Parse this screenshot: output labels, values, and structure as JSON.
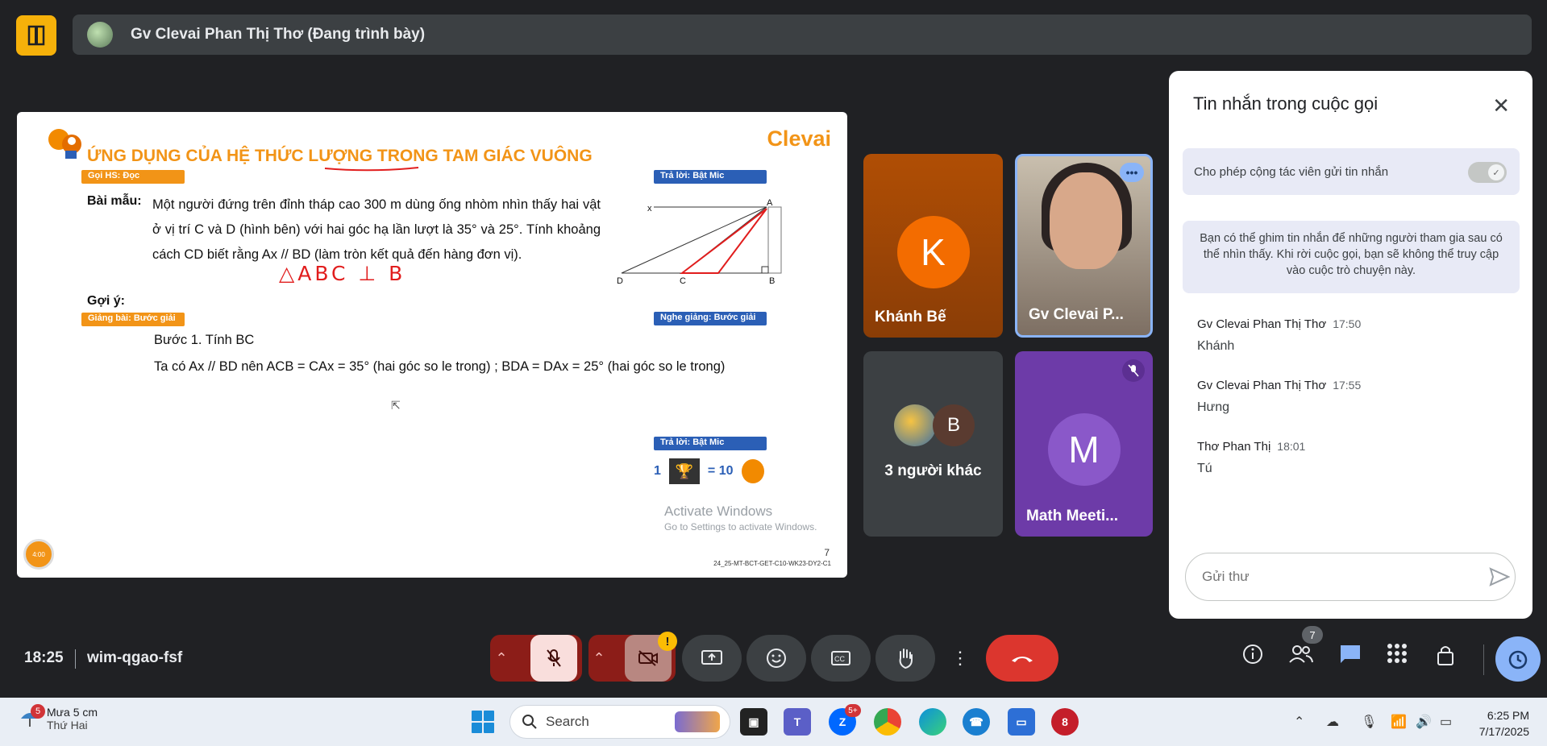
{
  "header": {
    "presenter_name": "Gv Clevai Phan Thị Thơ (Đang trình bày)"
  },
  "slide": {
    "title": "ỨNG DỤNG CỦA HỆ THỨC LƯỢNG TRONG TAM GIÁC VUÔNG",
    "brand": "Clevai",
    "tag_call_student": "Gọi HS: Đọc",
    "tag_answer_top": "Trả lời: Bật Mic",
    "sample_label": "Bài mẫu:",
    "problem": "Một người đứng trên đỉnh tháp cao 300 m dùng ống nhòm nhìn thấy hai vật ở vị trí C và D (hình bên) với hai góc hạ lần lượt là 35° và 25°. Tính khoảng cách CD biết rằng Ax // BD (làm tròn kết quả đến hàng đơn vị).",
    "handwriting": "△ABC ⊥ B",
    "hint_label": "Gợi ý:",
    "tag_lecture": "Giảng bài: Bước giải",
    "tag_listen": "Nghe giảng: Bước giải",
    "step1": "Bước 1. Tính BC",
    "equation": "Ta có Ax // BD nên ACB = CAx = 35° (hai góc so le trong) ; BDA = DAx = 25° (hai góc so le trong)",
    "tag_answer_bottom": "Trả lời: Bật Mic",
    "reward_count": "1",
    "reward_equals": "= 10",
    "diagram_labels": {
      "x": "x",
      "a": "A",
      "d": "D",
      "c": "C",
      "b": "B"
    },
    "activate_line1": "Activate Windows",
    "activate_line2": "Go to Settings to activate Windows.",
    "page_number": "7",
    "slide_code": "24_25-MT-BCT-GET-C10-WK23-DY2-C1",
    "timer": "4:00"
  },
  "participants": [
    {
      "name": "Khánh Bế",
      "initial": "K",
      "color": "#f36c00"
    },
    {
      "name": "Gv Clevai P..."
    },
    {
      "name": "3 người khác",
      "initial": "B"
    },
    {
      "name": "Math Meeti...",
      "initial": "M",
      "color": "#8a58c9"
    }
  ],
  "chat": {
    "title": "Tin nhắn trong cuộc gọi",
    "allow_label": "Cho phép cộng tác viên gửi tin nhắn",
    "info": "Bạn có thể ghim tin nhắn để những người tham gia sau có thể nhìn thấy. Khi rời cuộc gọi, bạn sẽ không thể truy cập vào cuộc trò chuyện này.",
    "messages": [
      {
        "sender": "Gv Clevai Phan Thị Thơ",
        "time": "17:50",
        "text": "Khánh"
      },
      {
        "sender": "Gv Clevai Phan Thị Thơ",
        "time": "17:55",
        "text": "Hưng"
      },
      {
        "sender": "Thơ Phan Thị",
        "time": "18:01",
        "text": "Tú"
      }
    ],
    "input_placeholder": "Gửi thư"
  },
  "meeting": {
    "time": "18:25",
    "code": "wim-qgao-fsf",
    "people_count": "7"
  },
  "taskbar": {
    "weather_badge": "5",
    "weather_line1": "Mưa 5 cm",
    "weather_line2": "Thứ Hai",
    "search_label": "Search",
    "zalo_badge": "5+",
    "time": "6:25 PM",
    "date": "7/17/2025"
  },
  "colors": {
    "accent_orange": "#f29417",
    "end_call": "#dc362e",
    "chat_active": "#8ab4f8"
  }
}
